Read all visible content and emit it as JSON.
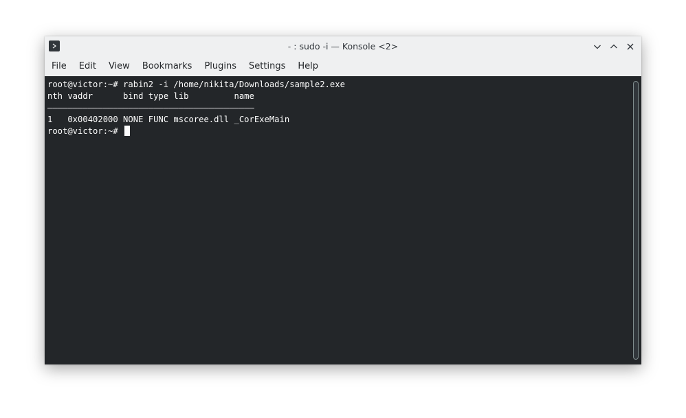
{
  "window": {
    "title": "- : sudo -i — Konsole <2>"
  },
  "menubar": {
    "items": [
      "File",
      "Edit",
      "View",
      "Bookmarks",
      "Plugins",
      "Settings",
      "Help"
    ]
  },
  "terminal": {
    "lines": [
      "root@victor:~# rabin2 -i /home/nikita/Downloads/sample2.exe",
      "nth vaddr      bind type lib         name",
      "―――――――――――――――――――――――――――――――――――――――――",
      "1   0x00402000 NONE FUNC mscoree.dll _CorExeMain",
      "root@victor:~# "
    ]
  },
  "icons": {
    "app": "konsole-icon",
    "minimize": "chevron-down-icon",
    "maximize": "chevron-up-icon",
    "close": "close-icon"
  },
  "colors": {
    "terminal_bg": "#232629",
    "terminal_fg": "#fcfcfc",
    "titlebar_bg": "#eff0f1"
  }
}
